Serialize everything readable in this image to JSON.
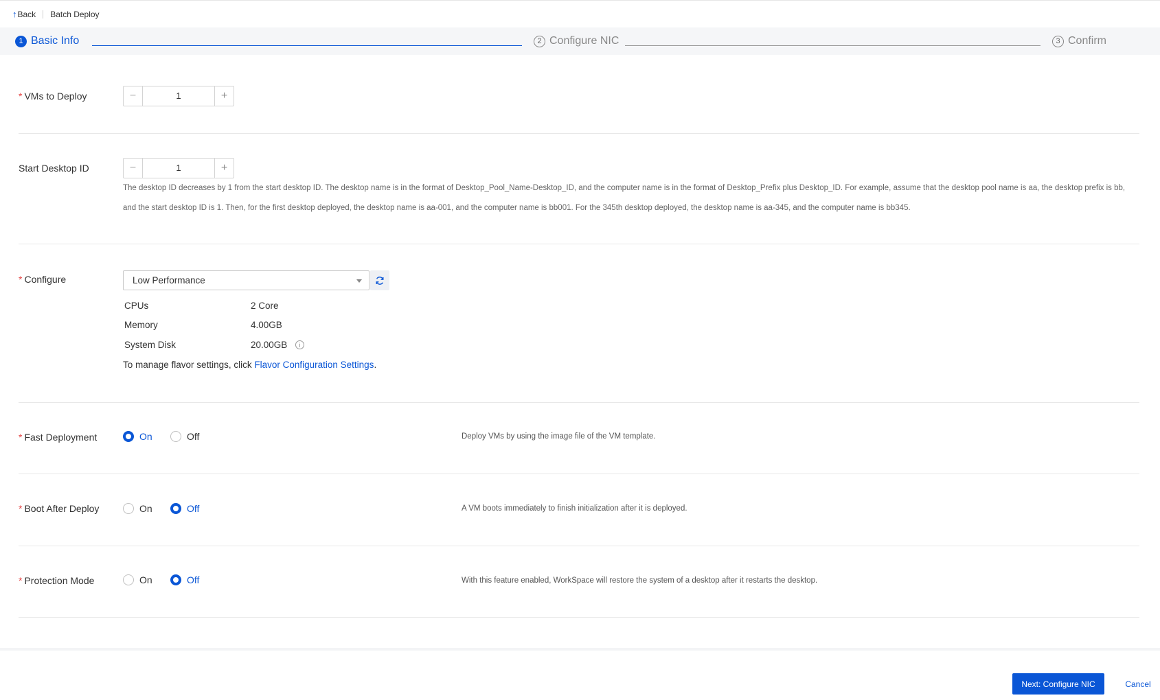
{
  "breadcrumb": {
    "back_label": "Back",
    "page_title": "Batch Deploy"
  },
  "steps": [
    {
      "num": "1",
      "label": "Basic Info"
    },
    {
      "num": "2",
      "label": "Configure NIC"
    },
    {
      "num": "3",
      "label": "Confirm"
    }
  ],
  "form": {
    "vms_to_deploy": {
      "label": "VMs to Deploy",
      "value": "1"
    },
    "start_desktop_id": {
      "label": "Start Desktop ID",
      "value": "1",
      "hint_line1": "The desktop ID decreases by 1 from the start desktop ID. The desktop name is in the format of Desktop_Pool_Name-Desktop_ID, and the computer name is in the format of Desktop_Prefix plus Desktop_ID. For example, assume that the desktop pool name is aa, the desktop prefix is bb,",
      "hint_line2": "and the start desktop ID is 1. Then, for the first desktop deployed, the desktop name is aa-001, and the computer name is bb001. For the 345th desktop deployed, the desktop name is aa-345, and the computer name is bb345."
    },
    "configure": {
      "label": "Configure",
      "selected": "Low Performance",
      "specs": [
        {
          "name": "CPUs",
          "value": "2 Core"
        },
        {
          "name": "Memory",
          "value": "4.00GB"
        },
        {
          "name": "System Disk",
          "value": "20.00GB"
        }
      ],
      "manage_prefix": "To manage flavor settings, click ",
      "manage_link": "Flavor Configuration Settings",
      "manage_suffix": "."
    },
    "fast_deployment": {
      "label": "Fast Deployment",
      "on": "On",
      "off": "Off",
      "selected": "On",
      "desc": "Deploy VMs by using the image file of the VM template."
    },
    "boot_after_deploy": {
      "label": "Boot After Deploy",
      "on": "On",
      "off": "Off",
      "selected": "Off",
      "desc": "A VM boots immediately to finish initialization after it is deployed."
    },
    "protection_mode": {
      "label": "Protection Mode",
      "on": "On",
      "off": "Off",
      "selected": "Off",
      "desc": "With this feature enabled, WorkSpace will restore the system of a desktop after it restarts the desktop."
    }
  },
  "footer": {
    "next_label": "Next: Configure NIC",
    "cancel_label": "Cancel"
  },
  "colors": {
    "accent": "#0a56d6",
    "required": "#e54545"
  }
}
